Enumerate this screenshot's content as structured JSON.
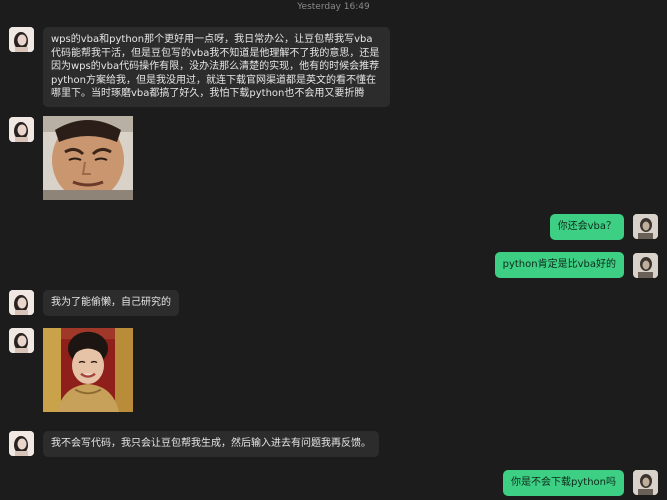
{
  "header": {
    "timestamp": "Yesterday 16:49"
  },
  "messages": [
    {
      "sender": "other",
      "type": "text",
      "text": "wps的vba和python那个更好用一点呀，我日常办公，让豆包帮我写vba代码能帮我干活，但是豆包写的vba我不知道是他理解不了我的意思，还是因为wps的vba代码操作有限，没办法那么清楚的实现，他有的时候会推荐python方案给我，但是我没用过，就连下载官网渠道都是英文的看不懂在哪里下。当时琢磨vba都搞了好久，我怕下载python也不会用又要折腾"
    },
    {
      "sender": "other",
      "type": "image",
      "image": "grimacing-man-meme"
    },
    {
      "sender": "self",
      "type": "text",
      "text": "你还会vba？"
    },
    {
      "sender": "self",
      "type": "text",
      "text": "python肯定是比vba好的"
    },
    {
      "sender": "other",
      "type": "text",
      "text": "我为了能偷懒，自己研究的"
    },
    {
      "sender": "other",
      "type": "image",
      "image": "smiling-woman-photo"
    },
    {
      "sender": "other",
      "type": "text",
      "text": "我不会写代码，我只会让豆包帮我生成，然后输入进去有问题我再反馈。"
    },
    {
      "sender": "self",
      "type": "text",
      "text": "你是不会下载python吗"
    }
  ],
  "colors": {
    "background": "#1c1c1c",
    "bubble_other": "#2c2c2c",
    "bubble_self": "#3dcf83"
  }
}
